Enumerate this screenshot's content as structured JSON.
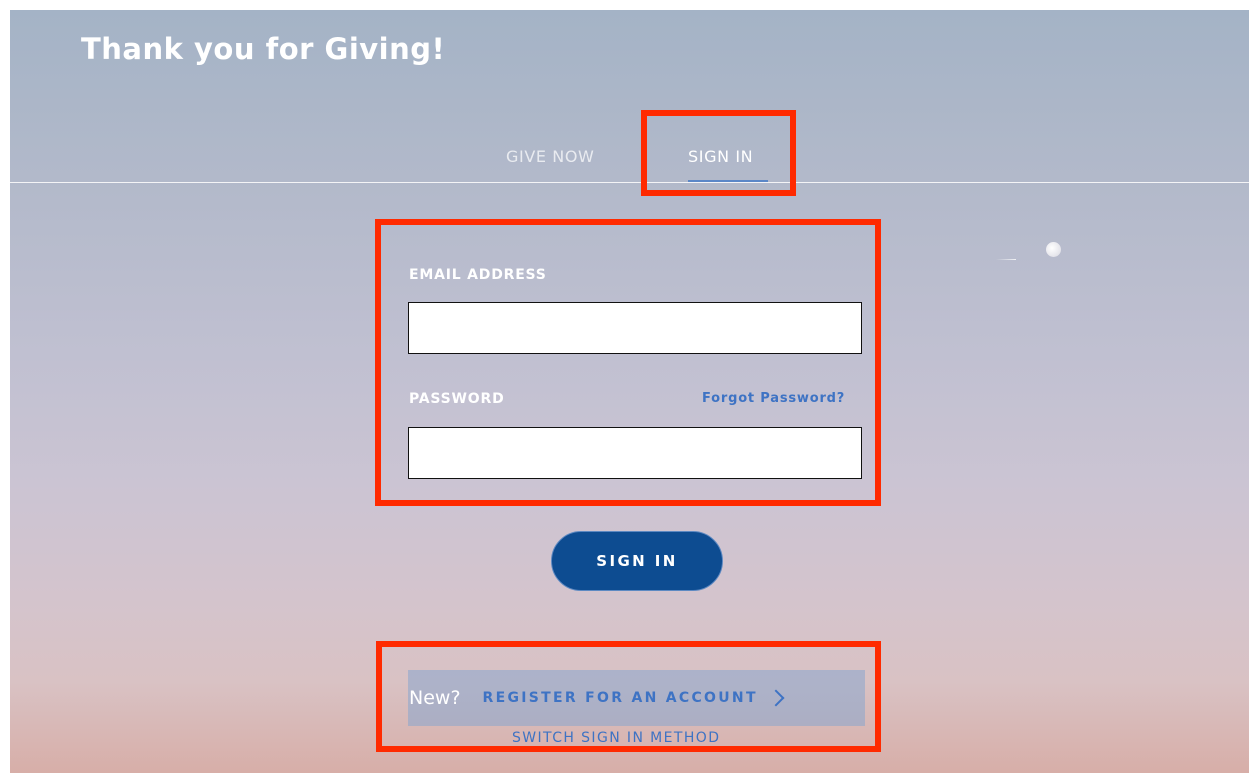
{
  "header": {
    "title": "Thank you for Giving!"
  },
  "tabs": [
    {
      "label": "GIVE NOW",
      "active": false
    },
    {
      "label": "SIGN IN",
      "active": true
    }
  ],
  "form": {
    "email_label": "EMAIL ADDRESS",
    "email_value": "",
    "password_label": "PASSWORD",
    "password_value": "",
    "forgot_label": "Forgot Password?",
    "submit_label": "SIGN IN"
  },
  "register": {
    "prompt": "New?",
    "link_label": "REGISTER FOR AN ACCOUNT",
    "switch_label": "SWITCH SIGN IN METHOD"
  },
  "colors": {
    "accent": "#0d4c91",
    "link": "#3e73c4",
    "highlight": "#ff2a00",
    "text_light": "#ffffff"
  },
  "icons": {
    "register_chevron": "chevron-right-icon"
  }
}
